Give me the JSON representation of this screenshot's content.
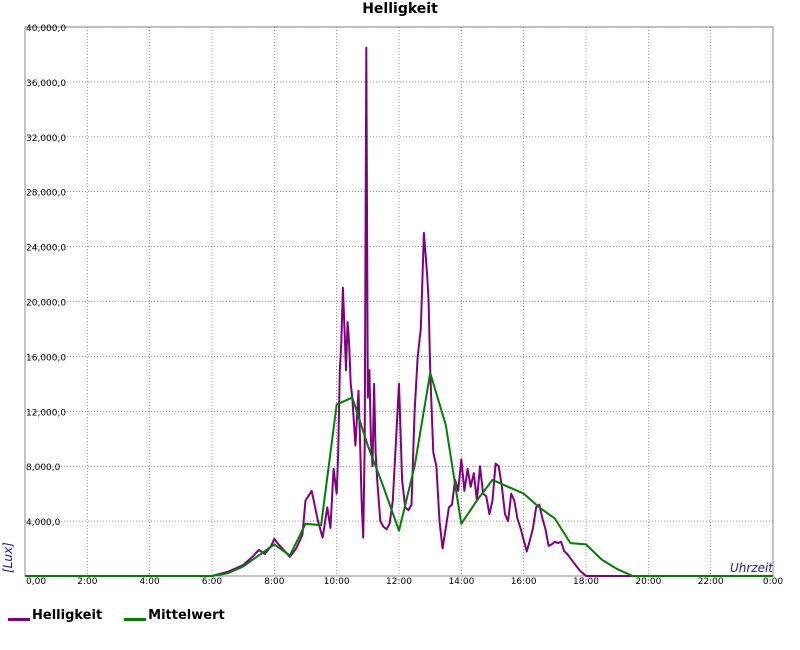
{
  "chart_data": {
    "type": "line",
    "title": "Helligkeit",
    "xlabel": "Uhrzeit",
    "ylabel": "[Lux]",
    "xlim": [
      0,
      24
    ],
    "ylim": [
      0,
      40000
    ],
    "grid": true,
    "legend_position": "bottom-left",
    "x_ticks": [
      "0,00",
      "2:00",
      "4:00",
      "6:00",
      "8:00",
      "10:00",
      "12:00",
      "14:00",
      "16:00",
      "18:00",
      "20:00",
      "22:00",
      "0:00"
    ],
    "y_ticks": [
      "4,000,0",
      "8,000,0",
      "12,000,0",
      "16,000,0",
      "20,000,0",
      "24,000,0",
      "28,000,0",
      "32,000,0",
      "36,000,0",
      "40,000,0"
    ],
    "series": [
      {
        "name": "Helligkeit",
        "color": "#800080",
        "x": [
          0,
          6.0,
          6.5,
          7.0,
          7.3,
          7.5,
          7.7,
          7.9,
          8.0,
          8.1,
          8.3,
          8.5,
          8.7,
          8.9,
          9.0,
          9.2,
          9.4,
          9.55,
          9.7,
          9.8,
          9.9,
          10.0,
          10.05,
          10.1,
          10.15,
          10.2,
          10.25,
          10.3,
          10.35,
          10.4,
          10.45,
          10.5,
          10.6,
          10.7,
          10.75,
          10.8,
          10.85,
          10.9,
          10.95,
          11.0,
          11.05,
          11.1,
          11.15,
          11.2,
          11.25,
          11.3,
          11.4,
          11.5,
          11.6,
          11.7,
          11.8,
          12.0,
          12.1,
          12.2,
          12.3,
          12.4,
          12.5,
          12.6,
          12.7,
          12.8,
          12.85,
          12.9,
          12.95,
          13.0,
          13.05,
          13.1,
          13.2,
          13.3,
          13.4,
          13.5,
          13.6,
          13.7,
          13.8,
          13.9,
          14.0,
          14.1,
          14.2,
          14.3,
          14.4,
          14.5,
          14.6,
          14.7,
          14.8,
          14.9,
          15.0,
          15.1,
          15.2,
          15.3,
          15.4,
          15.5,
          15.6,
          15.7,
          15.8,
          15.9,
          16.0,
          16.1,
          16.2,
          16.3,
          16.4,
          16.5,
          16.6,
          16.7,
          16.8,
          16.9,
          17.0,
          17.1,
          17.2,
          17.3,
          17.4,
          17.5,
          17.6,
          17.7,
          17.8,
          17.9,
          18.0,
          18.2,
          18.4,
          18.6,
          18.8,
          19.0,
          19.2,
          19.5,
          20.0,
          21.0,
          24.0
        ],
        "values": [
          0,
          0,
          300,
          800,
          1400,
          1900,
          1600,
          2200,
          2700,
          2400,
          1900,
          1400,
          2000,
          3000,
          5500,
          6200,
          4000,
          2800,
          5000,
          3500,
          7800,
          6000,
          9000,
          15000,
          17000,
          21000,
          18000,
          15000,
          18500,
          17000,
          14000,
          13000,
          9500,
          13500,
          10000,
          5500,
          2800,
          9500,
          38500,
          13000,
          15000,
          10000,
          8000,
          14000,
          9000,
          7000,
          4000,
          3600,
          3400,
          3800,
          5500,
          14000,
          7000,
          5000,
          4800,
          5200,
          12000,
          16000,
          18000,
          25000,
          23500,
          22000,
          20000,
          15000,
          12000,
          9000,
          8000,
          4000,
          2000,
          3500,
          5000,
          5200,
          7000,
          6200,
          8500,
          6200,
          7800,
          6500,
          7500,
          5500,
          8000,
          6000,
          5800,
          4500,
          5500,
          8200,
          8000,
          6500,
          4500,
          4000,
          6000,
          5500,
          4200,
          3500,
          2600,
          1800,
          2600,
          3500,
          5000,
          5200,
          4200,
          3400,
          2200,
          2300,
          2500,
          2400,
          2500,
          1800,
          1600,
          1300,
          1000,
          700,
          400,
          200,
          0,
          0,
          0,
          0,
          0,
          0,
          0,
          0,
          0,
          0,
          0
        ]
      },
      {
        "name": "Mittelwert",
        "color": "#008000",
        "x": [
          0,
          6.0,
          6.5,
          7.0,
          7.5,
          8.0,
          8.5,
          9.0,
          9.5,
          10.0,
          10.5,
          11.0,
          11.5,
          12.0,
          12.5,
          13.0,
          13.5,
          14.0,
          14.5,
          15.0,
          15.5,
          16.0,
          16.5,
          17.0,
          17.5,
          18.0,
          18.5,
          19.0,
          19.5,
          20.0,
          21.0,
          24.0
        ],
        "values": [
          0,
          0,
          200,
          700,
          1500,
          2300,
          1500,
          3800,
          3700,
          12500,
          13000,
          9500,
          6500,
          3300,
          8000,
          14800,
          11000,
          3800,
          5500,
          7000,
          6500,
          6000,
          5000,
          4200,
          2400,
          2300,
          1200,
          500,
          0,
          0,
          0,
          0
        ]
      }
    ]
  }
}
